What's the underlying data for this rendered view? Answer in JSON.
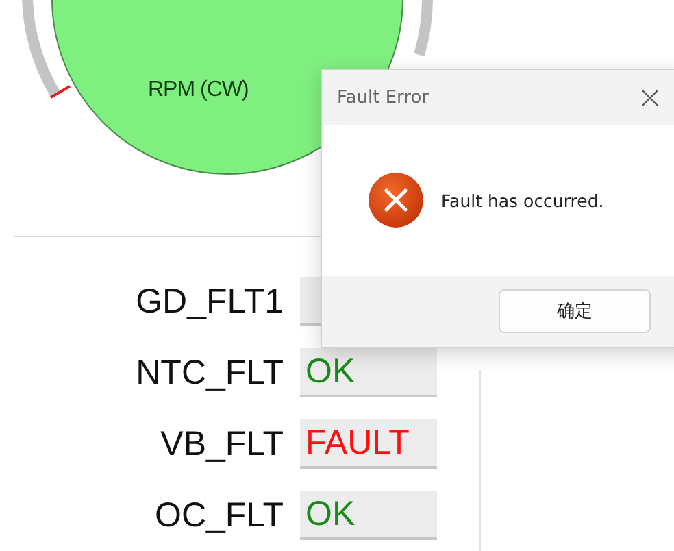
{
  "gauge": {
    "unit": "RPM (CW)"
  },
  "faults": [
    {
      "name": "GD_FLT1"
    },
    {
      "name": "NTC_FLT",
      "value": "OK",
      "color": "#1a8a1a"
    },
    {
      "name": "VB_FLT",
      "value": "FAULT",
      "color": "#ff1010"
    },
    {
      "name": "OC_FLT",
      "value": "OK",
      "color": "#1a8a1a"
    }
  ],
  "dialog": {
    "title": "Fault Error",
    "message": "Fault has occurred.",
    "button": "确定"
  }
}
